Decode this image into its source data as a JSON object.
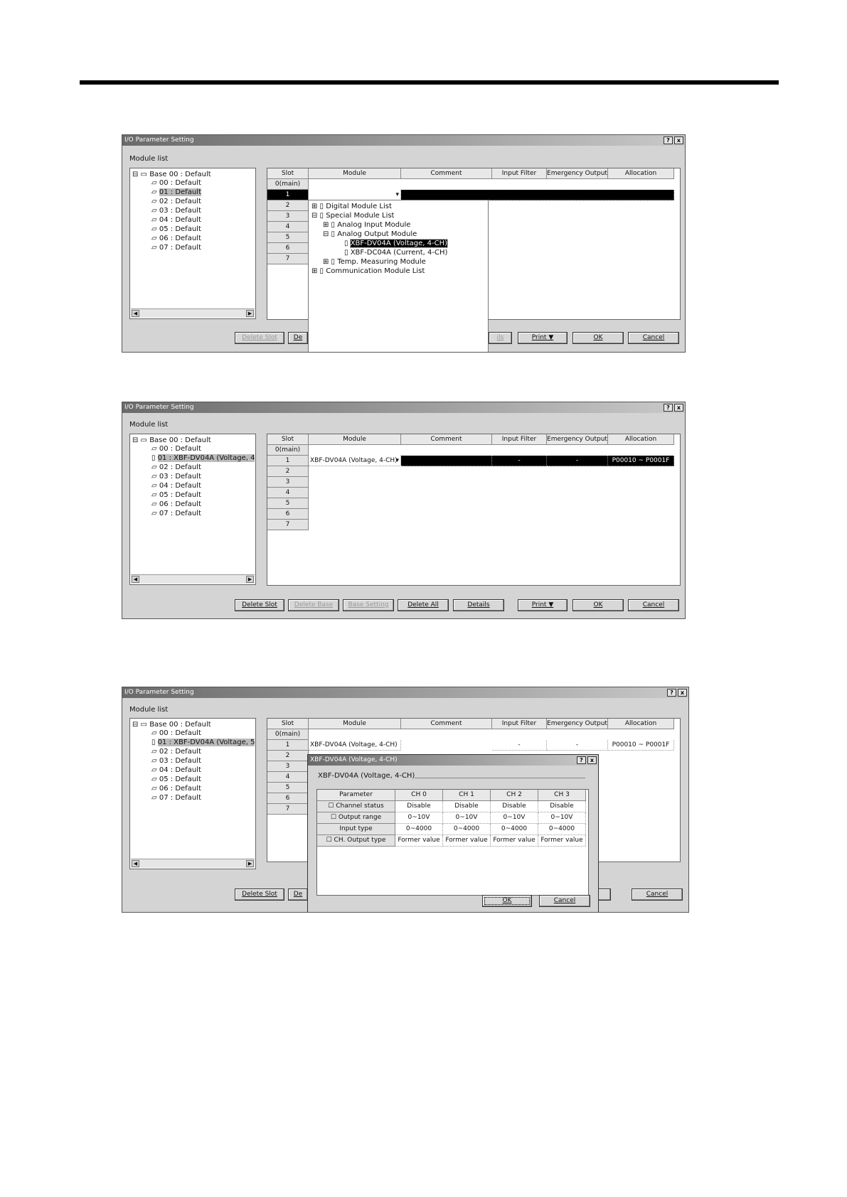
{
  "title": "I/O Parameter Setting",
  "module_list_label": "Module list",
  "title_help": "?",
  "title_close": "x",
  "columns": [
    "Slot",
    "Module",
    "Comment",
    "Input Filter",
    "Emergency Output",
    "Allocation"
  ],
  "slots": [
    "0(main)",
    "1",
    "2",
    "3",
    "4",
    "5",
    "6",
    "7"
  ],
  "panel1": {
    "tree": [
      "Base 00 : Default",
      "00 : Default",
      "01 : Default",
      "02 : Default",
      "03 : Default",
      "04 : Default",
      "05 : Default",
      "06 : Default",
      "07 : Default"
    ],
    "dropdown": [
      "Digital Module List",
      "Special Module List",
      "Analog Input Module",
      "Analog Output Module",
      "XBF-DV04A (Voltage, 4-CH)",
      "XBF-DC04A (Current, 4-CH)",
      "Temp. Measuring Module",
      "Communication Module List"
    ],
    "buttons": [
      "Delete Slot",
      "De",
      "ils",
      "Print ▼",
      "OK",
      "Cancel"
    ]
  },
  "panel2": {
    "tree": [
      "Base 00 : Default",
      "00 : Default",
      "01 : XBF-DV04A (Voltage, 4",
      "02 : Default",
      "03 : Default",
      "04 : Default",
      "05 : Default",
      "06 : Default",
      "07 : Default"
    ],
    "row1": {
      "module": "XBF-DV04A (Voltage, 4-CH)",
      "filter": "-",
      "emergency": "-",
      "allocation": "P00010 ~ P0001F"
    },
    "buttons": [
      "Delete Slot",
      "Delete Base",
      "Base Setting",
      "Delete All",
      "Details",
      "Print ▼",
      "OK",
      "Cancel"
    ]
  },
  "panel3": {
    "tree": [
      "Base 00 : Default",
      "00 : Default",
      "01 : XBF-DV04A (Voltage, 5",
      "02 : Default",
      "03 : Default",
      "04 : Default",
      "05 : Default",
      "06 : Default",
      "07 : Default"
    ],
    "row1": {
      "module": "XBF-DV04A (Voltage, 4-CH)",
      "filter": "-",
      "emergency": "-",
      "allocation": "P00010 ~ P0001F"
    },
    "buttons": [
      "Delete Slot",
      "De",
      "OK",
      "Cancel"
    ],
    "sub": {
      "title": "XBF-DV04A (Voltage, 4-CH)",
      "group": "XBF-DV04A (Voltage, 4-CH)",
      "headers": [
        "Parameter",
        "CH 0",
        "CH 1",
        "CH 2",
        "CH 3"
      ],
      "rows": [
        {
          "name": "Channel status",
          "cb": true,
          "vals": [
            "Disable",
            "Disable",
            "Disable",
            "Disable"
          ]
        },
        {
          "name": "Output range",
          "cb": true,
          "vals": [
            "0~10V",
            "0~10V",
            "0~10V",
            "0~10V"
          ]
        },
        {
          "name": "Input type",
          "cb": false,
          "vals": [
            "0~4000",
            "0~4000",
            "0~4000",
            "0~4000"
          ]
        },
        {
          "name": "CH. Output type",
          "cb": true,
          "vals": [
            "Former value",
            "Former value",
            "Former value",
            "Former value"
          ]
        }
      ],
      "ok": "OK",
      "cancel": "Cancel"
    }
  }
}
